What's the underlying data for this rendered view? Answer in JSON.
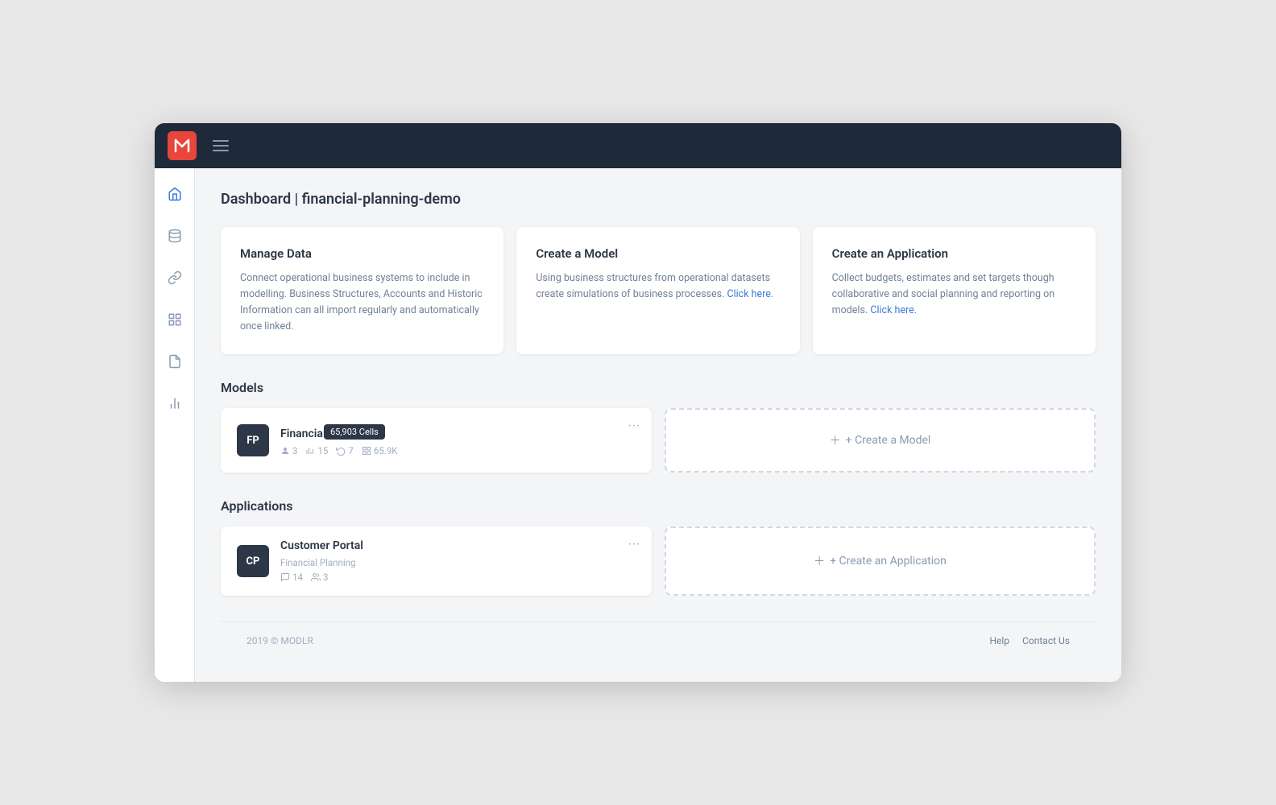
{
  "topNav": {
    "logoText": "M",
    "hamburgerLabel": "Menu"
  },
  "sidebar": {
    "items": [
      {
        "id": "home",
        "icon": "⌂",
        "label": "Home",
        "active": true
      },
      {
        "id": "data",
        "icon": "🗄",
        "label": "Data",
        "active": false
      },
      {
        "id": "link",
        "icon": "🔗",
        "label": "Link",
        "active": false
      },
      {
        "id": "models",
        "icon": "📊",
        "label": "Models",
        "active": false
      },
      {
        "id": "docs",
        "icon": "📄",
        "label": "Documents",
        "active": false
      },
      {
        "id": "reports",
        "icon": "📈",
        "label": "Reports",
        "active": false
      }
    ]
  },
  "breadcrumb": "Dashboard | financial-planning-demo",
  "infoCards": [
    {
      "id": "manage-data",
      "title": "Manage Data",
      "description": "Connect operational business systems to include in modelling. Business Structures, Accounts and Historic Information can all import regularly and automatically once linked.",
      "link": null
    },
    {
      "id": "create-model",
      "title": "Create a Model",
      "description": "Using business structures from operational datasets create simulations of business processes.",
      "linkText": "Click here.",
      "linkHref": "#"
    },
    {
      "id": "create-application",
      "title": "Create an Application",
      "description": "Collect budgets, estimates and set targets though collaborative and social planning and reporting on models.",
      "linkText": "Click here.",
      "linkHref": "#"
    }
  ],
  "modelsSection": {
    "title": "Models",
    "items": [
      {
        "id": "fp",
        "initials": "FP",
        "name": "Financial Pla...",
        "tooltip": "65,903 Cells",
        "meta": [
          {
            "icon": "●",
            "value": "3"
          },
          {
            "icon": "📊",
            "value": "15"
          },
          {
            "icon": "⟳",
            "value": "7"
          },
          {
            "icon": "⊞",
            "value": "65.9K"
          }
        ]
      }
    ],
    "createLabel": "+ Create a Model"
  },
  "applicationsSection": {
    "title": "Applications",
    "items": [
      {
        "id": "cp",
        "initials": "CP",
        "name": "Customer Portal",
        "subLabel": "Financial Planning",
        "meta": [
          {
            "icon": "💬",
            "value": "14"
          },
          {
            "icon": "👥",
            "value": "3"
          }
        ]
      }
    ],
    "createLabel": "+ Create an Application"
  },
  "footer": {
    "copyright": "2019 © MODLR",
    "links": [
      {
        "label": "Help",
        "href": "#"
      },
      {
        "label": "Contact Us",
        "href": "#"
      }
    ]
  }
}
